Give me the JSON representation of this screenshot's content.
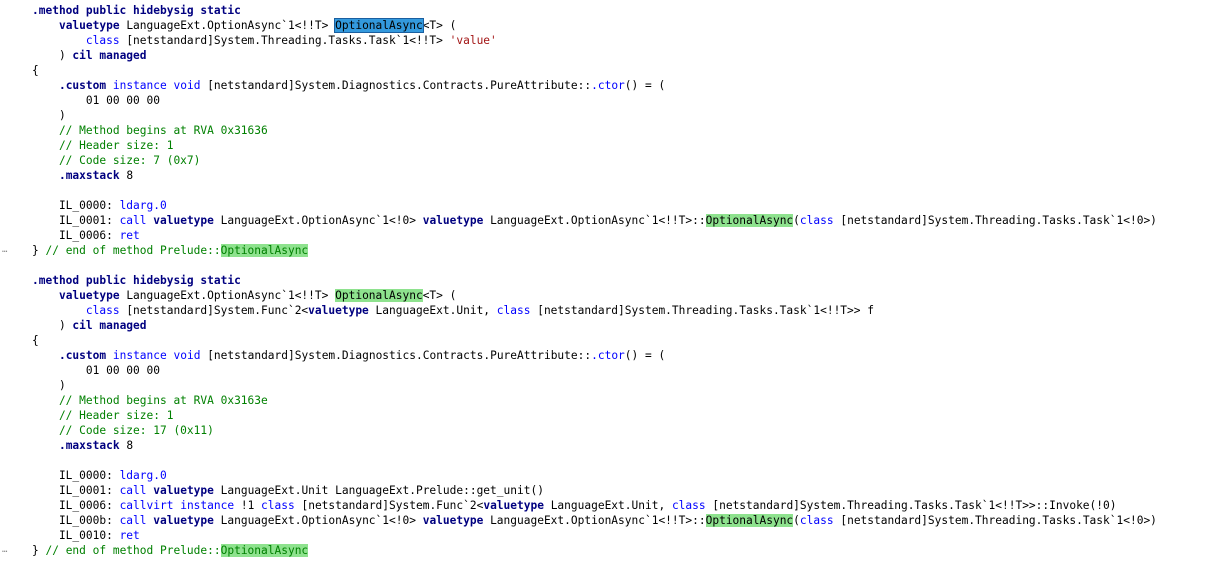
{
  "editor": {
    "search_term": "OptionalAsync",
    "lines": [
      [
        {
          "t": ".method public hidebysig static",
          "c": "dir"
        }
      ],
      [
        {
          "t": "    "
        },
        {
          "t": "valuetype",
          "c": "dir"
        },
        {
          "t": " LanguageExt.OptionAsync`1<!!T> "
        },
        {
          "t": "OptionalAsync",
          "c": "sel"
        },
        {
          "t": "<T> ("
        }
      ],
      [
        {
          "t": "        "
        },
        {
          "t": "class",
          "c": "kw"
        },
        {
          "t": " [netstandard]System.Threading.Tasks.Task`1<!!T> "
        },
        {
          "t": "'value'",
          "c": "str"
        }
      ],
      [
        {
          "t": "    ) "
        },
        {
          "t": "cil managed",
          "c": "dir"
        }
      ],
      [
        {
          "t": "{"
        }
      ],
      [
        {
          "t": "    "
        },
        {
          "t": ".custom",
          "c": "dir"
        },
        {
          "t": " "
        },
        {
          "t": "instance",
          "c": "kw"
        },
        {
          "t": " "
        },
        {
          "t": "void",
          "c": "kw"
        },
        {
          "t": " [netstandard]System.Diagnostics.Contracts.PureAttribute::"
        },
        {
          "t": ".ctor",
          "c": "kw"
        },
        {
          "t": "() = ("
        }
      ],
      [
        {
          "t": "        01 00 00 00"
        }
      ],
      [
        {
          "t": "    )"
        }
      ],
      [
        {
          "t": "    // Method begins at RVA 0x31636",
          "c": "cmt"
        }
      ],
      [
        {
          "t": "    // Header size: 1",
          "c": "cmt"
        }
      ],
      [
        {
          "t": "    // Code size: 7 (0x7)",
          "c": "cmt"
        }
      ],
      [
        {
          "t": "    "
        },
        {
          "t": ".maxstack",
          "c": "dir"
        },
        {
          "t": " 8"
        }
      ],
      [
        {
          "t": ""
        }
      ],
      [
        {
          "t": "    IL_0000: "
        },
        {
          "t": "ldarg.0",
          "c": "kw"
        }
      ],
      [
        {
          "t": "    IL_0001: "
        },
        {
          "t": "call",
          "c": "kw"
        },
        {
          "t": " "
        },
        {
          "t": "valuetype",
          "c": "dir"
        },
        {
          "t": " LanguageExt.OptionAsync`1<!0> "
        },
        {
          "t": "valuetype",
          "c": "dir"
        },
        {
          "t": " LanguageExt.OptionAsync`1<!!T>::"
        },
        {
          "t": "OptionalAsync",
          "c": "hl"
        },
        {
          "t": "("
        },
        {
          "t": "class",
          "c": "kw"
        },
        {
          "t": " [netstandard]System.Threading.Tasks.Task`1<!0>)"
        }
      ],
      [
        {
          "t": "    IL_0006: "
        },
        {
          "t": "ret",
          "c": "kw"
        }
      ],
      [
        {
          "t": "} "
        },
        {
          "t": "// end of method Prelude::",
          "c": "cmt"
        },
        {
          "t": "OptionalAsync",
          "c": "hl cmt"
        }
      ],
      [
        {
          "t": ""
        }
      ],
      [
        {
          "t": ".method public hidebysig static",
          "c": "dir"
        }
      ],
      [
        {
          "t": "    "
        },
        {
          "t": "valuetype",
          "c": "dir"
        },
        {
          "t": " LanguageExt.OptionAsync`1<!!T> "
        },
        {
          "t": "OptionalAsync",
          "c": "hl"
        },
        {
          "t": "<T> ("
        }
      ],
      [
        {
          "t": "        "
        },
        {
          "t": "class",
          "c": "kw"
        },
        {
          "t": " [netstandard]System.Func`2<"
        },
        {
          "t": "valuetype",
          "c": "dir"
        },
        {
          "t": " LanguageExt.Unit, "
        },
        {
          "t": "class",
          "c": "kw"
        },
        {
          "t": " [netstandard]System.Threading.Tasks.Task`1<!!T>> f"
        }
      ],
      [
        {
          "t": "    ) "
        },
        {
          "t": "cil managed",
          "c": "dir"
        }
      ],
      [
        {
          "t": "{"
        }
      ],
      [
        {
          "t": "    "
        },
        {
          "t": ".custom",
          "c": "dir"
        },
        {
          "t": " "
        },
        {
          "t": "instance",
          "c": "kw"
        },
        {
          "t": " "
        },
        {
          "t": "void",
          "c": "kw"
        },
        {
          "t": " [netstandard]System.Diagnostics.Contracts.PureAttribute::"
        },
        {
          "t": ".ctor",
          "c": "kw"
        },
        {
          "t": "() = ("
        }
      ],
      [
        {
          "t": "        01 00 00 00"
        }
      ],
      [
        {
          "t": "    )"
        }
      ],
      [
        {
          "t": "    // Method begins at RVA 0x3163e",
          "c": "cmt"
        }
      ],
      [
        {
          "t": "    // Header size: 1",
          "c": "cmt"
        }
      ],
      [
        {
          "t": "    // Code size: 17 (0x11)",
          "c": "cmt"
        }
      ],
      [
        {
          "t": "    "
        },
        {
          "t": ".maxstack",
          "c": "dir"
        },
        {
          "t": " 8"
        }
      ],
      [
        {
          "t": ""
        }
      ],
      [
        {
          "t": "    IL_0000: "
        },
        {
          "t": "ldarg.0",
          "c": "kw"
        }
      ],
      [
        {
          "t": "    IL_0001: "
        },
        {
          "t": "call",
          "c": "kw"
        },
        {
          "t": " "
        },
        {
          "t": "valuetype",
          "c": "dir"
        },
        {
          "t": " LanguageExt.Unit LanguageExt.Prelude::get_unit()"
        }
      ],
      [
        {
          "t": "    IL_0006: "
        },
        {
          "t": "callvirt",
          "c": "kw"
        },
        {
          "t": " "
        },
        {
          "t": "instance",
          "c": "kw"
        },
        {
          "t": " !1 "
        },
        {
          "t": "class",
          "c": "kw"
        },
        {
          "t": " [netstandard]System.Func`2<"
        },
        {
          "t": "valuetype",
          "c": "dir"
        },
        {
          "t": " LanguageExt.Unit, "
        },
        {
          "t": "class",
          "c": "kw"
        },
        {
          "t": " [netstandard]System.Threading.Tasks.Task`1<!!T>>::Invoke(!0)"
        }
      ],
      [
        {
          "t": "    IL_000b: "
        },
        {
          "t": "call",
          "c": "kw"
        },
        {
          "t": " "
        },
        {
          "t": "valuetype",
          "c": "dir"
        },
        {
          "t": " LanguageExt.OptionAsync`1<!0> "
        },
        {
          "t": "valuetype",
          "c": "dir"
        },
        {
          "t": " LanguageExt.OptionAsync`1<!!T>::"
        },
        {
          "t": "OptionalAsync",
          "c": "hl"
        },
        {
          "t": "("
        },
        {
          "t": "class",
          "c": "kw"
        },
        {
          "t": " [netstandard]System.Threading.Tasks.Task`1<!0>)"
        }
      ],
      [
        {
          "t": "    IL_0010: "
        },
        {
          "t": "ret",
          "c": "kw"
        }
      ],
      [
        {
          "t": "} "
        },
        {
          "t": "// end of method Prelude::",
          "c": "cmt"
        },
        {
          "t": "OptionalAsync",
          "c": "hl cmt"
        }
      ]
    ]
  }
}
